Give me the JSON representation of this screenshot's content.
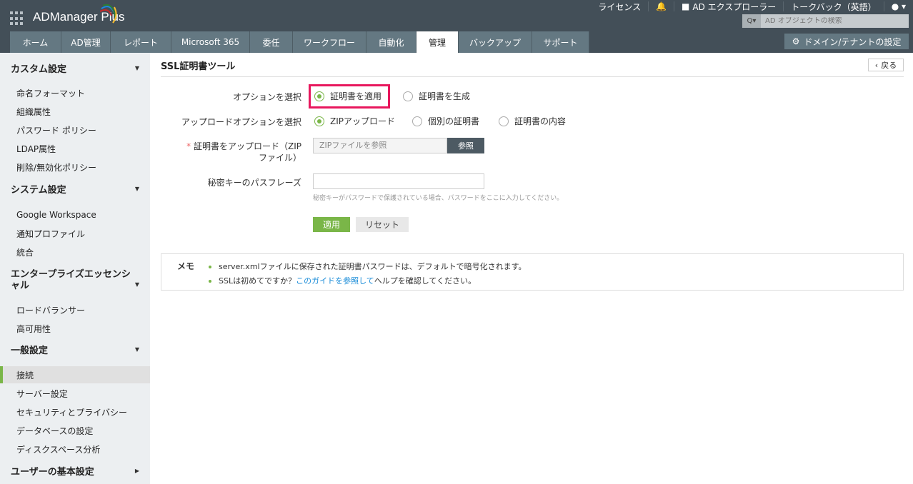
{
  "header": {
    "app_name": "ADManager Plus",
    "links": [
      "ライセンス",
      "AD エクスプローラー",
      "トークバック（英語）"
    ],
    "search_placeholder": "AD オブジェクトの検索",
    "domain_button": "ドメイン/テナントの設定"
  },
  "tabs": [
    "ホーム",
    "AD管理",
    "レポート",
    "Microsoft 365",
    "委任",
    "ワークフロー",
    "自動化",
    "管理",
    "バックアップ",
    "サポート"
  ],
  "active_tab": "管理",
  "sidebar": {
    "sections": [
      {
        "title": "カスタム設定",
        "items": [
          "命名フォーマット",
          "組織属性",
          "パスワード ポリシー",
          "LDAP属性",
          "削除/無効化ポリシー"
        ]
      },
      {
        "title": "システム設定",
        "items": [
          "Google Workspace",
          "通知プロファイル",
          "統合"
        ]
      },
      {
        "title": "エンタープライズエッセンシャル",
        "items": [
          "ロードバランサー",
          "高可用性"
        ]
      },
      {
        "title": "一般設定",
        "items": [
          "接続",
          "サーバー設定",
          "セキュリティとプライバシー",
          "データベースの設定",
          "ディスクスペース分析"
        ]
      },
      {
        "title": "ユーザーの基本設定",
        "items": []
      }
    ],
    "active_item": "接続"
  },
  "main": {
    "title": "SSL証明書ツール",
    "back": "戻る",
    "option_label": "オプションを選択",
    "options": [
      "証明書を適用",
      "証明書を生成"
    ],
    "upload_option_label": "アップロードオプションを選択",
    "upload_options": [
      "ZIPアップロード",
      "個別の証明書",
      "証明書の内容"
    ],
    "upload_label": "証明書をアップロード（ZIPファイル）",
    "required_mark": "*",
    "file_placeholder": "ZIPファイルを参照",
    "browse": "参照",
    "passphrase_label": "秘密キーのパスフレーズ",
    "passphrase_value": "",
    "hint": "秘密キーがパスワードで保護されている場合、パスワードをここに入力してください。",
    "apply": "適用",
    "reset": "リセット",
    "memo": {
      "title": "メモ",
      "note1": "server.xmlファイルに保存された証明書パスワードは、デフォルトで暗号化されます。",
      "note2_pre": "SSLは初めてですか？",
      "note2_link": "このガイドを参照して",
      "note2_post": "ヘルプを確認してください。"
    }
  }
}
